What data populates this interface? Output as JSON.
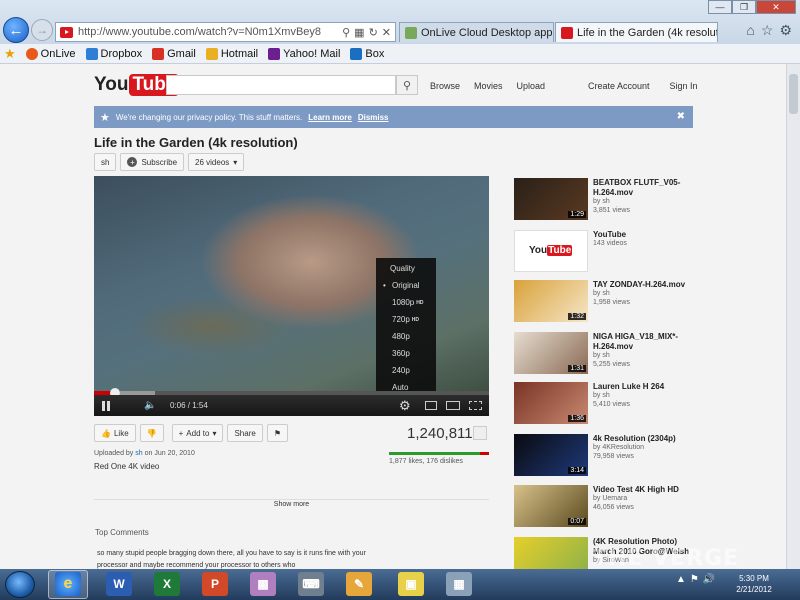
{
  "browser": {
    "url": "http://www.youtube.com/watch?v=N0m1XmvBey8",
    "tabs": [
      {
        "title": "OnLive Cloud Desktop app no...",
        "active": false
      },
      {
        "title": "Life in the Garden (4k resolutio...",
        "active": true
      }
    ],
    "favorites": [
      "OnLive",
      "Dropbox",
      "Gmail",
      "Hotmail",
      "Yahoo! Mail",
      "Box"
    ]
  },
  "youtube": {
    "logo_you": "You",
    "logo_tube": "Tube",
    "nav": [
      "Browse",
      "Movies",
      "Upload"
    ],
    "account": [
      "Create Account",
      "Sign In"
    ],
    "banner": {
      "text": "We're changing our privacy policy. This stuff matters.",
      "learn_more": "Learn more",
      "dismiss": "Dismiss"
    },
    "video": {
      "title": "Life in the Garden (4k resolution)",
      "channel": "sh",
      "subscribe": "Subscribe",
      "videos": "26 videos",
      "time": "0:06 / 1:54",
      "progress": 0.053,
      "quality_menu": [
        "Quality",
        "Original",
        "1080p",
        "720p",
        "480p",
        "360p",
        "240p",
        "Auto"
      ],
      "hd_badge": "HD",
      "views": "1,240,811",
      "likes_ratio": 0.91,
      "likes": "1,877 likes, 176 dislikes",
      "uploaded_prefix": "Uploaded by",
      "uploaded_user": "sh",
      "uploaded_date": "on Jun 20, 2010",
      "description": "Red One 4K video",
      "show_more": "Show more"
    },
    "actions": {
      "like": "Like",
      "add_to": "Add to",
      "share": "Share"
    },
    "comments": {
      "header": "Top Comments",
      "text": "so many stupid people bragging down there, all you have to say is it runs fine with your processor and maybe recommend your processor to others who"
    },
    "sidebar": [
      {
        "title": "BEATBOX FLUTF_V05-",
        "title2": "H.264.mov",
        "by": "by sh",
        "views": "3,851 views",
        "duration": "1:29",
        "colors": [
          "#2a2018",
          "#5a3a22"
        ]
      },
      {
        "title": "YouTube",
        "title2": "",
        "by": "143 videos",
        "views": "",
        "duration": "",
        "colors": [
          "#ffffff",
          "#ffffff"
        ]
      },
      {
        "title": "TAY ZONDAY-H.264.mov",
        "title2": "",
        "by": "by sh",
        "views": "1,958 views",
        "duration": "1:32",
        "colors": [
          "#d9a23a",
          "#f5e6c8"
        ]
      },
      {
        "title": "NIGA HIGA_V18_MIX*-",
        "title2": "H.264.mov",
        "by": "by sh",
        "views": "5,255 views",
        "duration": "1:31",
        "colors": [
          "#e6ddd0",
          "#8a6a55"
        ]
      },
      {
        "title": "Lauren Luke H 264",
        "title2": "",
        "by": "by sh",
        "views": "5,410 views",
        "duration": "1:36",
        "colors": [
          "#7a3324",
          "#c88a72"
        ]
      },
      {
        "title": "4k Resolution (2304p)",
        "title2": "",
        "by": "by 4KResolution",
        "views": "79,958 views",
        "duration": "3:14",
        "colors": [
          "#0a0a10",
          "#1e3a7a"
        ]
      },
      {
        "title": "Video Test 4K High HD",
        "title2": "",
        "by": "by Uemara",
        "views": "46,056 views",
        "duration": "0:07",
        "colors": [
          "#d8c28a",
          "#5a4a20"
        ]
      },
      {
        "title": "(4K Resolution Photo)",
        "title2": "March 2010 Goro@Welsh",
        "by": "by SiroWan",
        "views": "",
        "duration": "",
        "colors": [
          "#e6cf2a",
          "#8ab04a"
        ]
      }
    ]
  },
  "taskbar": {
    "time": "5:30 PM",
    "date": "2/21/2012"
  },
  "watermark": "THE VERGE"
}
